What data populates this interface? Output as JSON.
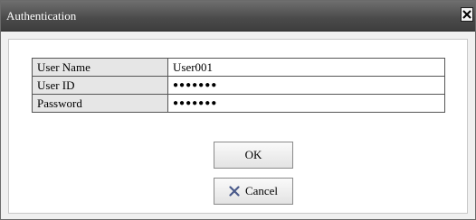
{
  "dialog": {
    "title": "Authentication",
    "close_icon": "close-icon"
  },
  "form": {
    "rows": [
      {
        "label": "User Name",
        "value": "User001"
      },
      {
        "label": "User ID",
        "value": "●●●●●●●"
      },
      {
        "label": "Password",
        "value": "●●●●●●●"
      }
    ]
  },
  "buttons": {
    "ok_label": "OK",
    "cancel_label": "Cancel",
    "cancel_icon": "x-icon"
  }
}
